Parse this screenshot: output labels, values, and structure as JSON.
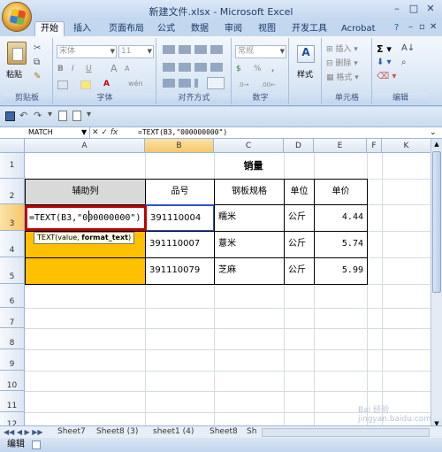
{
  "window": {
    "title": "新建文件.xlsx - Microsoft Excel"
  },
  "tabs": [
    {
      "label": "开始",
      "active": true
    },
    {
      "label": "插入"
    },
    {
      "label": "页面布局"
    },
    {
      "label": "公式"
    },
    {
      "label": "数据"
    },
    {
      "label": "审阅"
    },
    {
      "label": "视图"
    },
    {
      "label": "开发工具"
    },
    {
      "label": "Acrobat"
    }
  ],
  "ribbon": {
    "paste_label": "粘贴",
    "font_name": "宋体",
    "font_size": "11",
    "bold": "B",
    "italic": "I",
    "underline": "U",
    "font_grow": "A",
    "font_shrink": "A",
    "wen": "wén",
    "number_format": "常规",
    "percent": "%",
    "comma": ",",
    "style_label": "样式",
    "insert_label": "插入",
    "delete_label": "删除",
    "format_label": "格式",
    "groups": {
      "clipboard": "剪贴板",
      "font": "字体",
      "alignment": "对齐方式",
      "number": "数字",
      "cells": "单元格",
      "editing": "编辑"
    }
  },
  "formula_bar": {
    "name_box": "MATCH",
    "fx": "fx",
    "formula": "=TEXT(B3,\"000000000\")"
  },
  "columns": [
    "A",
    "B",
    "C",
    "D",
    "E",
    "F",
    "K"
  ],
  "rows": [
    "1",
    "2",
    "3",
    "4",
    "5",
    "6",
    "7",
    "8",
    "9",
    "10",
    "11",
    "12"
  ],
  "sheet": {
    "title": "销量",
    "headers": [
      "辅助列",
      "品号",
      "钢板规格",
      "单位",
      "单价"
    ],
    "editing_formula": "=TEXT(B3,\"000000000\")",
    "tooltip": {
      "prefix": "TEXT(value, ",
      "bold": "format_text",
      "suffix": ")"
    },
    "data": [
      {
        "code": "391110004",
        "name": "糯米",
        "unit": "公斤",
        "price": "4.44"
      },
      {
        "code": "391110007",
        "name": "薏米",
        "unit": "公斤",
        "price": "5.74"
      },
      {
        "code": "391110079",
        "name": "芝麻",
        "unit": "公斤",
        "price": "5.99"
      }
    ]
  },
  "sheet_tabs": [
    "Sheet7",
    "Sheet8 (3)",
    "sheet1 (4)",
    "Sheet8",
    "Sh"
  ],
  "status": {
    "mode": "编辑"
  },
  "watermark": "Bai 经验\njingyan.baidu.com",
  "colors": {
    "highlight": "#ffc000",
    "header_fill": "#d9d9d9",
    "edit_border": "#c00000"
  }
}
